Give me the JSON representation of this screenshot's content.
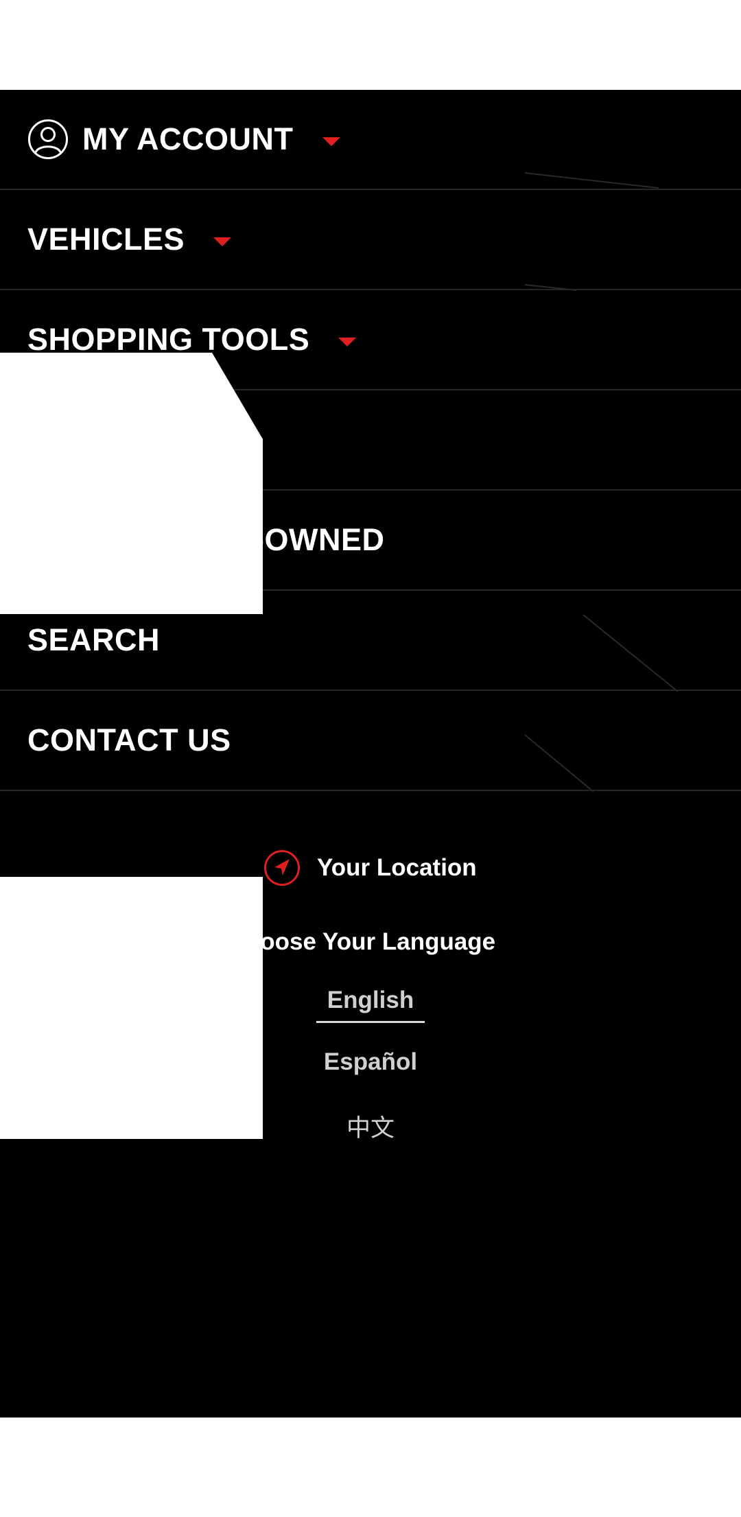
{
  "nav": {
    "items": [
      {
        "label": "MY ACCOUNT",
        "icon": "user-circle-icon",
        "has_caret": true
      },
      {
        "label": "VEHICLES",
        "has_caret": true
      },
      {
        "label": "SHOPPING TOOLS",
        "has_caret": true
      },
      {
        "label": ""
      },
      {
        "label": "-OWNED"
      },
      {
        "label": "SEARCH"
      },
      {
        "label": "CONTACT US"
      }
    ]
  },
  "location": {
    "label": "Your Location",
    "icon": "location-arrow-icon"
  },
  "language": {
    "heading": "hoose Your Language",
    "options": [
      {
        "label": "English",
        "selected": true
      },
      {
        "label": "Español",
        "selected": false
      },
      {
        "label": "中文",
        "selected": false
      }
    ]
  },
  "colors": {
    "background": "#000000",
    "text": "#ffffff",
    "accent": "#e02020",
    "divider": "#262626",
    "muted_text": "#d0d0d0"
  }
}
